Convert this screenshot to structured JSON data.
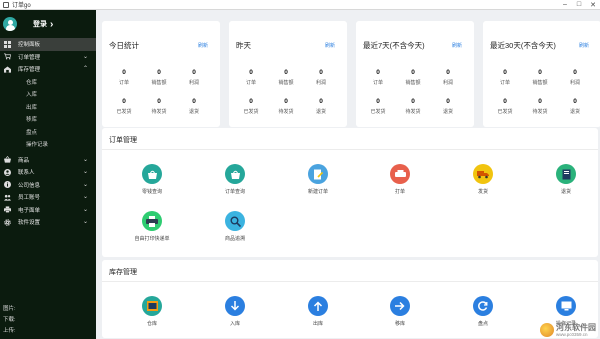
{
  "window": {
    "title": "订单go"
  },
  "sidebar": {
    "login_label": "登录",
    "items": [
      {
        "label": "控制面板",
        "icon": "dashboard-icon"
      },
      {
        "label": "订单管理",
        "icon": "cart-icon"
      },
      {
        "label": "库存管理",
        "icon": "warehouse-icon"
      }
    ],
    "sub_items": [
      "仓库",
      "入库",
      "出库",
      "移库",
      "盘点",
      "操作记录"
    ],
    "items2": [
      {
        "label": "商品",
        "icon": "basket-icon"
      },
      {
        "label": "联系人",
        "icon": "contact-icon"
      },
      {
        "label": "公司信息",
        "icon": "info-icon"
      },
      {
        "label": "员工账号",
        "icon": "staff-icon"
      },
      {
        "label": "电子面单",
        "icon": "printer-icon"
      },
      {
        "label": "软件设置",
        "icon": "gear-icon"
      }
    ],
    "footer": [
      "图片:",
      "下载:",
      "上传:"
    ]
  },
  "stats": [
    {
      "title": "今日统计",
      "refresh": "刷新",
      "values": [
        "0",
        "0",
        "0",
        "0",
        "0",
        "0"
      ]
    },
    {
      "title": "昨天",
      "refresh": "刷新",
      "values": [
        "0",
        "0",
        "0",
        "0",
        "0",
        "0"
      ]
    },
    {
      "title": "最近7天(不含今天)",
      "refresh": "刷新",
      "values": [
        "0",
        "0",
        "0",
        "0",
        "0",
        "0"
      ]
    },
    {
      "title": "最近30天(不含今天)",
      "refresh": "刷新",
      "values": [
        "0",
        "0",
        "0",
        "0",
        "0",
        "0"
      ]
    }
  ],
  "stat_labels": [
    "订单",
    "销售额",
    "利润",
    "已发货",
    "待发货",
    "退货"
  ],
  "order_panel": {
    "title": "订单管理",
    "tiles": [
      {
        "label": "零钱查询",
        "icon": "search-bag-icon",
        "color": "#25a79a"
      },
      {
        "label": "订单查询",
        "icon": "search-bag-icon",
        "color": "#25a79a"
      },
      {
        "label": "新建订单",
        "icon": "new-order-icon",
        "color": "#4aa3df"
      },
      {
        "label": "打单",
        "icon": "print-order-icon",
        "color": "#e8604c"
      },
      {
        "label": "发货",
        "icon": "truck-icon",
        "color": "#f1c40f"
      },
      {
        "label": "退货",
        "icon": "return-icon",
        "color": "#2ab27b"
      },
      {
        "label": "自由打印快递单",
        "icon": "printer-icon",
        "color": "#2ecc71"
      },
      {
        "label": "商品追溯",
        "icon": "trace-icon",
        "color": "#3bb3e0"
      }
    ]
  },
  "stock_panel": {
    "title": "库存管理",
    "tiles": [
      {
        "label": "仓库",
        "icon": "warehouse-icon",
        "color": "#25a79a"
      },
      {
        "label": "入库",
        "icon": "arrow-down-icon",
        "color": "#2b7fe0"
      },
      {
        "label": "出库",
        "icon": "arrow-up-icon",
        "color": "#2b7fe0"
      },
      {
        "label": "移库",
        "icon": "arrow-right-icon",
        "color": "#2b7fe0"
      },
      {
        "label": "盘点",
        "icon": "refresh-icon",
        "color": "#2b7fe0"
      },
      {
        "label": "操作记录",
        "icon": "monitor-icon",
        "color": "#2b7fe0"
      }
    ]
  },
  "watermark": {
    "text": "河东软件园",
    "url": "www.pc0359.cn"
  }
}
